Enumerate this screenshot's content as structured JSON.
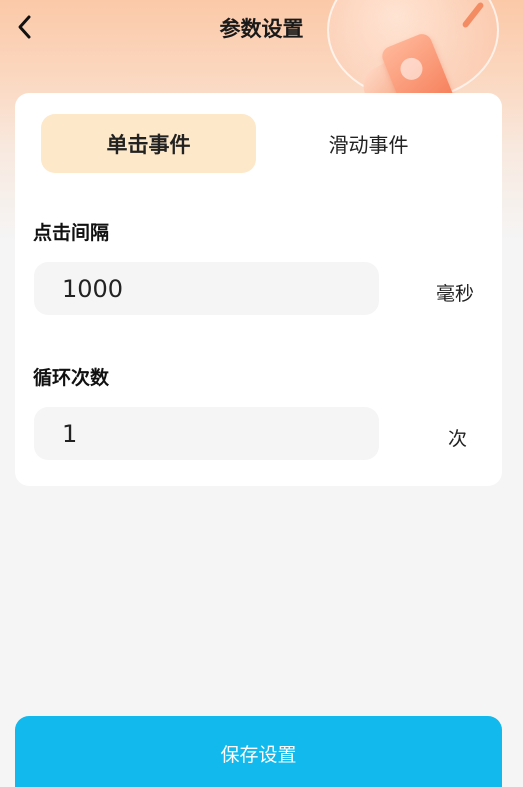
{
  "header": {
    "title": "参数设置",
    "back_icon": "chevron-left-icon"
  },
  "tabs": [
    {
      "label": "单击事件",
      "active": true
    },
    {
      "label": "滑动事件",
      "active": false
    }
  ],
  "fields": {
    "interval": {
      "label": "点击间隔",
      "value": "1000",
      "unit": "毫秒"
    },
    "loop_count": {
      "label": "循环次数",
      "value": "1",
      "unit": "次"
    }
  },
  "save_button": {
    "label": "保存设置"
  },
  "colors": {
    "accent": "#12b9ec",
    "active_tab": "#fde8c9",
    "header_gradient_top": "#fbc9a8"
  }
}
